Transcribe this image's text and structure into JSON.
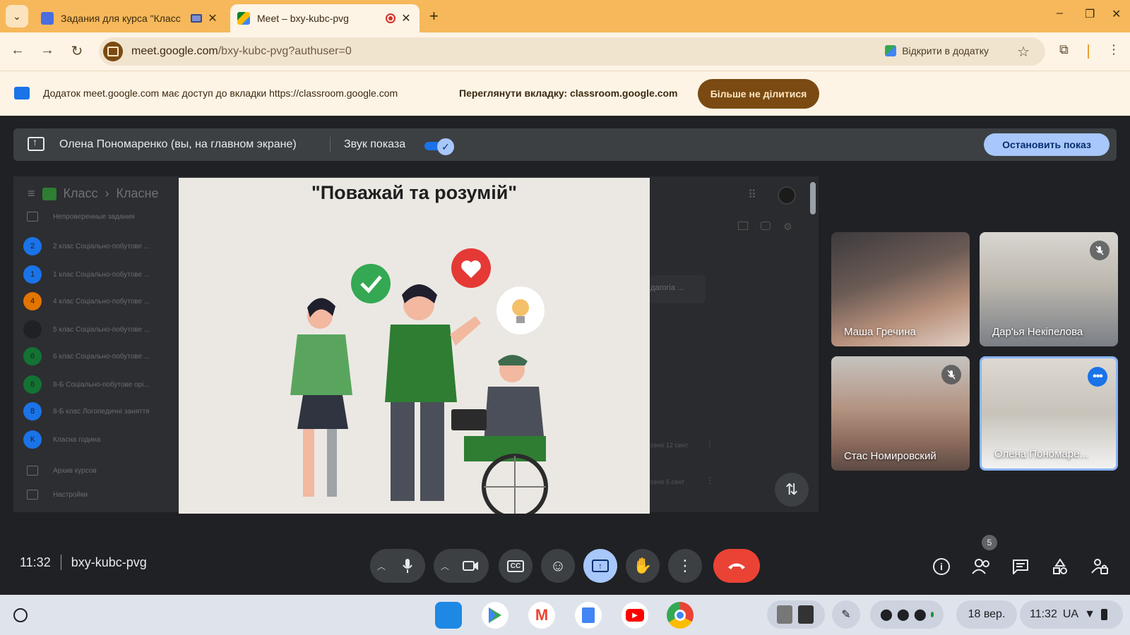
{
  "browser": {
    "tabs": [
      {
        "title": "Задания для курса \"Класс",
        "active": false
      },
      {
        "title": "Meet – bxy-kubc-pvg",
        "active": true
      }
    ],
    "url_host": "meet.google.com",
    "url_path": "/bxy-kubc-pvg?authuser=0",
    "open_in_app": "Відкрити в додатку"
  },
  "share_infobar": {
    "message": "Додаток meet.google.com має доступ до вкладки https://classroom.google.com",
    "view_tab": "Переглянути вкладку: classroom.google.com",
    "stop_sharing": "Більше не ділитися"
  },
  "presenting_bar": {
    "presenter": "Олена Пономаренко (вы, на главном экране)",
    "audio_label": "Звук показа",
    "audio_enabled": true,
    "stop_label": "Остановить показ"
  },
  "classroom": {
    "breadcrumb": [
      "Класс",
      "Класне"
    ],
    "side_items": [
      {
        "avatar": "",
        "label": "Непроверенные задания",
        "color": ""
      },
      {
        "avatar": "2",
        "label": "2 клас Соціально-побутове ...",
        "color": "#1a73e8"
      },
      {
        "avatar": "1",
        "label": "1 клас Соціально-побутове ...",
        "color": "#1a73e8"
      },
      {
        "avatar": "4",
        "label": "4 клас Соціально-побутове ...",
        "color": "#e37400"
      },
      {
        "avatar": "5",
        "label": "5 клас Соціально-побутове ...",
        "color": "#202124"
      },
      {
        "avatar": "6",
        "label": "6 клас Соціально-побутове ...",
        "color": "#137333"
      },
      {
        "avatar": "8",
        "label": "8-Б Соціально-побутове орі...",
        "color": "#137333"
      },
      {
        "avatar": "8",
        "label": "8-Б клас Логопедичні заняття",
        "color": "#1a73e8"
      },
      {
        "avatar": "К",
        "label": "Класна година",
        "color": "#1a73e8"
      },
      {
        "avatar": "",
        "label": "Архив курсов",
        "color": ""
      },
      {
        "avatar": "",
        "label": "Настройки",
        "color": ""
      }
    ],
    "right_fragment": "дагогіа ...",
    "right_dates": [
      "сено 12 сент",
      "сено 5 сент"
    ]
  },
  "slide": {
    "title": "\"Поважай та розумій\""
  },
  "participants": [
    {
      "name": "Маша Гречина",
      "muted": false,
      "active": false
    },
    {
      "name": "Дар'ья Некіпелова",
      "muted": true,
      "active": false
    },
    {
      "name": "Стас Номировский",
      "muted": true,
      "active": false
    },
    {
      "name": "Олена Пономаре...",
      "muted": false,
      "active": true
    }
  ],
  "meeting": {
    "time": "11:32",
    "code": "bxy-kubc-pvg",
    "people_count": "5"
  },
  "shelf": {
    "date": "18 вер.",
    "time": "11:32",
    "lang": "UA"
  },
  "colors": {
    "tab_strip": "#f6b85a",
    "meet_bg": "#202124",
    "hangup": "#ea4335",
    "present_active": "#a8c7fa"
  }
}
